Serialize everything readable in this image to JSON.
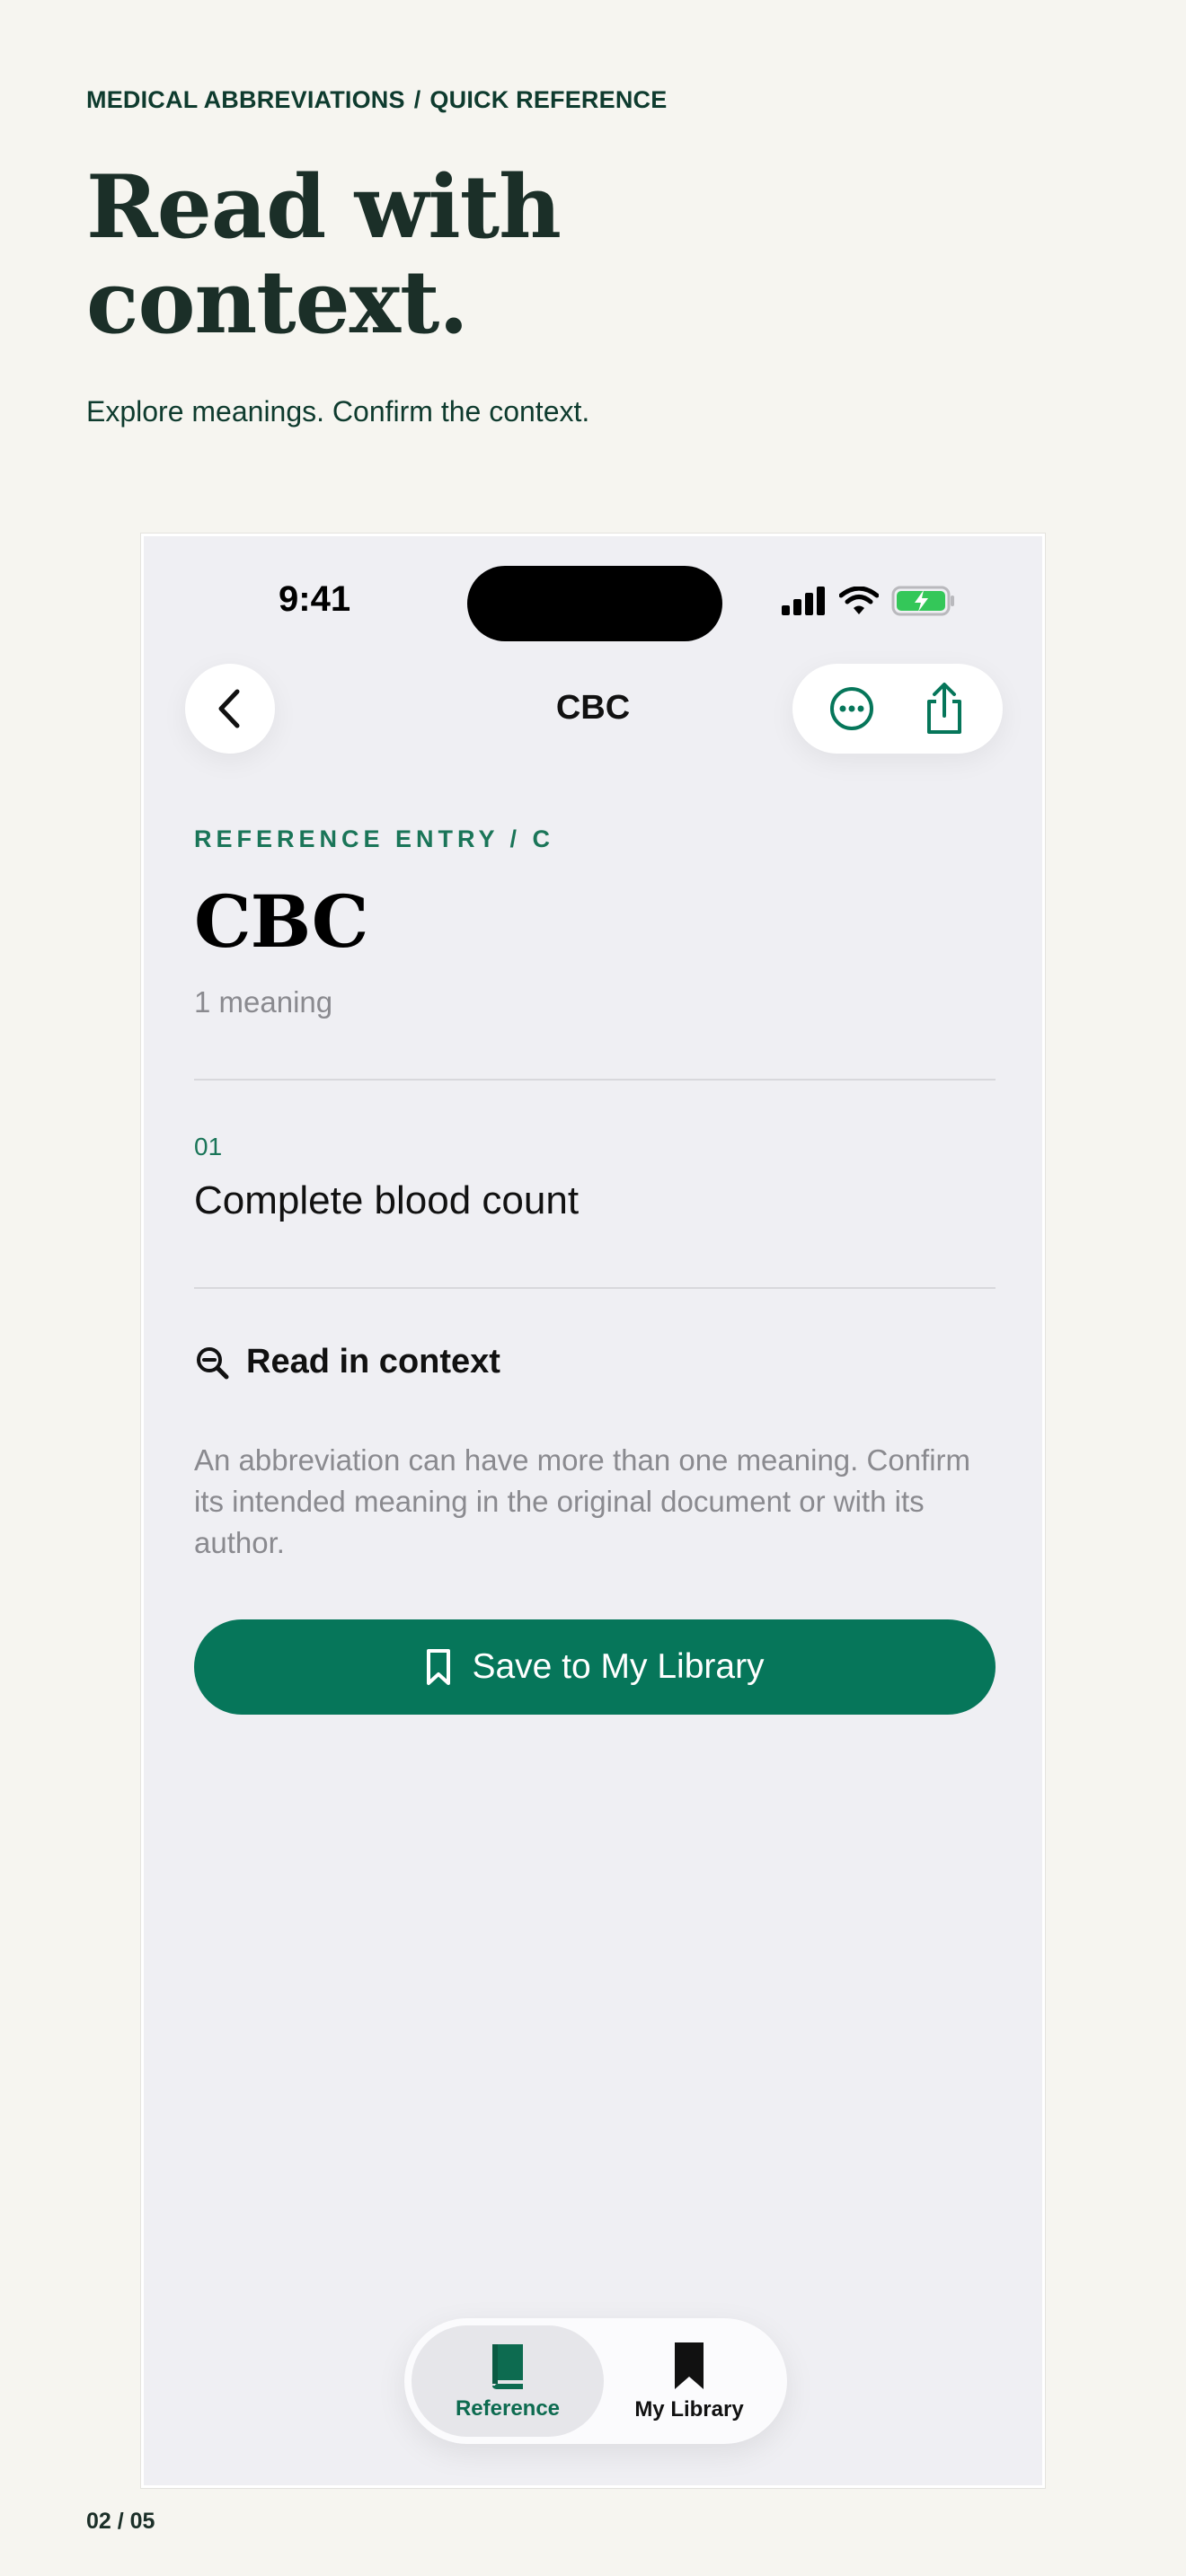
{
  "header": {
    "breadcrumb": [
      "MEDICAL ABBREVIATIONS",
      "/",
      "QUICK REFERENCE"
    ],
    "headline": [
      "Read with",
      "context."
    ],
    "tagline": "Explore meanings. Confirm the context."
  },
  "status_bar": {
    "time": "9:41"
  },
  "nav": {
    "title": "CBC",
    "back_icon": "chevron-left-icon",
    "more_icon": "ellipsis-circle-icon",
    "share_icon": "share-icon"
  },
  "entry": {
    "label": "REFERENCE ENTRY / C",
    "title": "CBC",
    "count": "1 meaning",
    "meanings": [
      {
        "number": "01",
        "text": "Complete blood count"
      }
    ]
  },
  "context": {
    "title": "Read in context",
    "icon": "magnifier-minus-icon",
    "body": "An abbreviation can have more than one meaning. Confirm its intended meaning in the original document or with its author."
  },
  "actions": {
    "save_label": "Save to My Library",
    "save_icon": "bookmark-icon"
  },
  "tabbar": {
    "tabs": [
      {
        "label": "Reference",
        "icon": "book-icon",
        "active": true
      },
      {
        "label": "My Library",
        "icon": "bookmark-filled-icon",
        "active": false
      }
    ]
  },
  "page_counter": "02 / 05",
  "colors": {
    "accent": "#06765a",
    "background": "#f6f5f0",
    "screen": "#efeff3",
    "battery": "#34c759"
  }
}
